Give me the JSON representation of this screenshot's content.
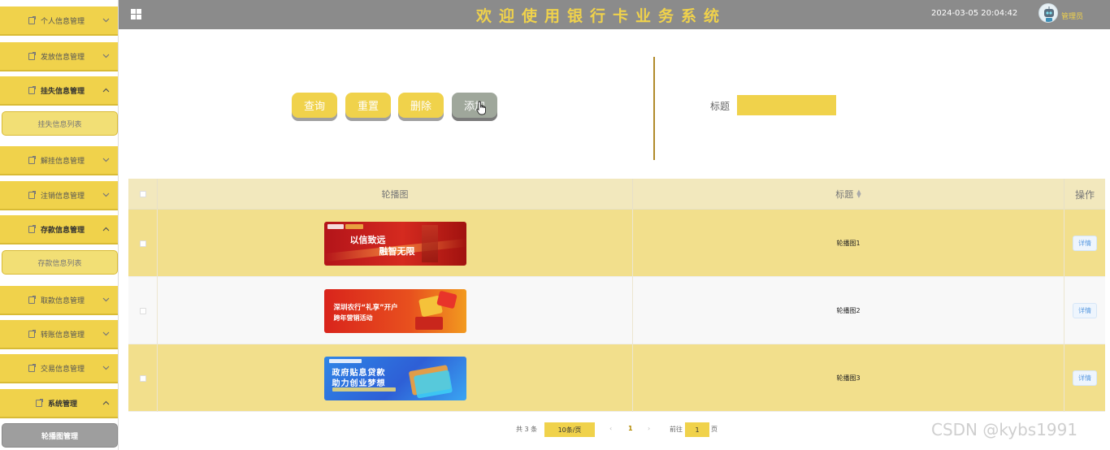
{
  "header": {
    "title": "欢迎使用银行卡业务系统",
    "datetime": "2024-03-05 20:04:42",
    "user": "管理员"
  },
  "sidebar": {
    "groups": [
      {
        "label": "个人信息管理",
        "open": false
      },
      {
        "label": "发放信息管理",
        "open": false
      },
      {
        "label": "挂失信息管理",
        "open": true,
        "sub": "挂失信息列表"
      },
      {
        "label": "解挂信息管理",
        "open": false
      },
      {
        "label": "注销信息管理",
        "open": false
      },
      {
        "label": "存款信息管理",
        "open": true,
        "sub": "存款信息列表"
      },
      {
        "label": "取款信息管理",
        "open": false
      },
      {
        "label": "转账信息管理",
        "open": false
      },
      {
        "label": "交易信息管理",
        "open": false
      },
      {
        "label": "系统管理",
        "open": true,
        "sub": "轮播图管理"
      }
    ]
  },
  "toolbar": {
    "query": "查询",
    "reset": "重置",
    "delete": "删除",
    "add": "添加"
  },
  "search": {
    "label": "标题",
    "value": ""
  },
  "table": {
    "headers": {
      "image": "轮播图",
      "title": "标题",
      "actions": "操作"
    },
    "rows": [
      {
        "title": "轮播图1",
        "banner_line1": "以信致远",
        "banner_line2": "融智无限",
        "action": "详情"
      },
      {
        "title": "轮播图2",
        "banner_line1": "深圳农行“礼享”开户",
        "banner_line2": "跨年营销活动",
        "action": "详情"
      },
      {
        "title": "轮播图3",
        "banner_line1": "政府贴息贷款",
        "banner_line2": "助力创业梦想",
        "action": "详情"
      }
    ]
  },
  "pagination": {
    "total": "共 3 条",
    "page_size": "10条/页",
    "current": "1",
    "goto_label": "前往",
    "goto_value": "1",
    "page_suffix": "页"
  },
  "watermark": "CSDN @kybs1991",
  "colors": {
    "accent": "#f0d24b",
    "header": "#8b8b8b",
    "active_sub": "#9e9e9e",
    "divider": "#b08a2a"
  }
}
